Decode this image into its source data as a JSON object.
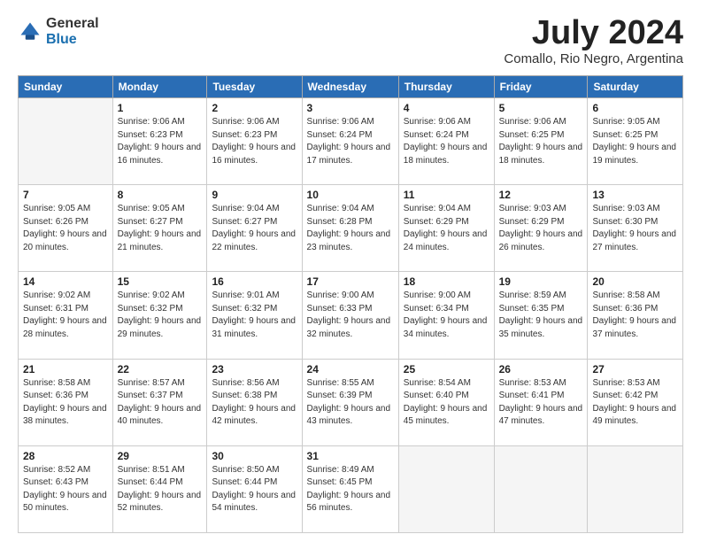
{
  "header": {
    "logo_general": "General",
    "logo_blue": "Blue",
    "month_title": "July 2024",
    "location": "Comallo, Rio Negro, Argentina"
  },
  "calendar": {
    "days_of_week": [
      "Sunday",
      "Monday",
      "Tuesday",
      "Wednesday",
      "Thursday",
      "Friday",
      "Saturday"
    ],
    "weeks": [
      [
        {
          "day": "",
          "sunrise": "",
          "sunset": "",
          "daylight": ""
        },
        {
          "day": "1",
          "sunrise": "Sunrise: 9:06 AM",
          "sunset": "Sunset: 6:23 PM",
          "daylight": "Daylight: 9 hours and 16 minutes."
        },
        {
          "day": "2",
          "sunrise": "Sunrise: 9:06 AM",
          "sunset": "Sunset: 6:23 PM",
          "daylight": "Daylight: 9 hours and 16 minutes."
        },
        {
          "day": "3",
          "sunrise": "Sunrise: 9:06 AM",
          "sunset": "Sunset: 6:24 PM",
          "daylight": "Daylight: 9 hours and 17 minutes."
        },
        {
          "day": "4",
          "sunrise": "Sunrise: 9:06 AM",
          "sunset": "Sunset: 6:24 PM",
          "daylight": "Daylight: 9 hours and 18 minutes."
        },
        {
          "day": "5",
          "sunrise": "Sunrise: 9:06 AM",
          "sunset": "Sunset: 6:25 PM",
          "daylight": "Daylight: 9 hours and 18 minutes."
        },
        {
          "day": "6",
          "sunrise": "Sunrise: 9:05 AM",
          "sunset": "Sunset: 6:25 PM",
          "daylight": "Daylight: 9 hours and 19 minutes."
        }
      ],
      [
        {
          "day": "7",
          "sunrise": "Sunrise: 9:05 AM",
          "sunset": "Sunset: 6:26 PM",
          "daylight": "Daylight: 9 hours and 20 minutes."
        },
        {
          "day": "8",
          "sunrise": "Sunrise: 9:05 AM",
          "sunset": "Sunset: 6:27 PM",
          "daylight": "Daylight: 9 hours and 21 minutes."
        },
        {
          "day": "9",
          "sunrise": "Sunrise: 9:04 AM",
          "sunset": "Sunset: 6:27 PM",
          "daylight": "Daylight: 9 hours and 22 minutes."
        },
        {
          "day": "10",
          "sunrise": "Sunrise: 9:04 AM",
          "sunset": "Sunset: 6:28 PM",
          "daylight": "Daylight: 9 hours and 23 minutes."
        },
        {
          "day": "11",
          "sunrise": "Sunrise: 9:04 AM",
          "sunset": "Sunset: 6:29 PM",
          "daylight": "Daylight: 9 hours and 24 minutes."
        },
        {
          "day": "12",
          "sunrise": "Sunrise: 9:03 AM",
          "sunset": "Sunset: 6:29 PM",
          "daylight": "Daylight: 9 hours and 26 minutes."
        },
        {
          "day": "13",
          "sunrise": "Sunrise: 9:03 AM",
          "sunset": "Sunset: 6:30 PM",
          "daylight": "Daylight: 9 hours and 27 minutes."
        }
      ],
      [
        {
          "day": "14",
          "sunrise": "Sunrise: 9:02 AM",
          "sunset": "Sunset: 6:31 PM",
          "daylight": "Daylight: 9 hours and 28 minutes."
        },
        {
          "day": "15",
          "sunrise": "Sunrise: 9:02 AM",
          "sunset": "Sunset: 6:32 PM",
          "daylight": "Daylight: 9 hours and 29 minutes."
        },
        {
          "day": "16",
          "sunrise": "Sunrise: 9:01 AM",
          "sunset": "Sunset: 6:32 PM",
          "daylight": "Daylight: 9 hours and 31 minutes."
        },
        {
          "day": "17",
          "sunrise": "Sunrise: 9:00 AM",
          "sunset": "Sunset: 6:33 PM",
          "daylight": "Daylight: 9 hours and 32 minutes."
        },
        {
          "day": "18",
          "sunrise": "Sunrise: 9:00 AM",
          "sunset": "Sunset: 6:34 PM",
          "daylight": "Daylight: 9 hours and 34 minutes."
        },
        {
          "day": "19",
          "sunrise": "Sunrise: 8:59 AM",
          "sunset": "Sunset: 6:35 PM",
          "daylight": "Daylight: 9 hours and 35 minutes."
        },
        {
          "day": "20",
          "sunrise": "Sunrise: 8:58 AM",
          "sunset": "Sunset: 6:36 PM",
          "daylight": "Daylight: 9 hours and 37 minutes."
        }
      ],
      [
        {
          "day": "21",
          "sunrise": "Sunrise: 8:58 AM",
          "sunset": "Sunset: 6:36 PM",
          "daylight": "Daylight: 9 hours and 38 minutes."
        },
        {
          "day": "22",
          "sunrise": "Sunrise: 8:57 AM",
          "sunset": "Sunset: 6:37 PM",
          "daylight": "Daylight: 9 hours and 40 minutes."
        },
        {
          "day": "23",
          "sunrise": "Sunrise: 8:56 AM",
          "sunset": "Sunset: 6:38 PM",
          "daylight": "Daylight: 9 hours and 42 minutes."
        },
        {
          "day": "24",
          "sunrise": "Sunrise: 8:55 AM",
          "sunset": "Sunset: 6:39 PM",
          "daylight": "Daylight: 9 hours and 43 minutes."
        },
        {
          "day": "25",
          "sunrise": "Sunrise: 8:54 AM",
          "sunset": "Sunset: 6:40 PM",
          "daylight": "Daylight: 9 hours and 45 minutes."
        },
        {
          "day": "26",
          "sunrise": "Sunrise: 8:53 AM",
          "sunset": "Sunset: 6:41 PM",
          "daylight": "Daylight: 9 hours and 47 minutes."
        },
        {
          "day": "27",
          "sunrise": "Sunrise: 8:53 AM",
          "sunset": "Sunset: 6:42 PM",
          "daylight": "Daylight: 9 hours and 49 minutes."
        }
      ],
      [
        {
          "day": "28",
          "sunrise": "Sunrise: 8:52 AM",
          "sunset": "Sunset: 6:43 PM",
          "daylight": "Daylight: 9 hours and 50 minutes."
        },
        {
          "day": "29",
          "sunrise": "Sunrise: 8:51 AM",
          "sunset": "Sunset: 6:44 PM",
          "daylight": "Daylight: 9 hours and 52 minutes."
        },
        {
          "day": "30",
          "sunrise": "Sunrise: 8:50 AM",
          "sunset": "Sunset: 6:44 PM",
          "daylight": "Daylight: 9 hours and 54 minutes."
        },
        {
          "day": "31",
          "sunrise": "Sunrise: 8:49 AM",
          "sunset": "Sunset: 6:45 PM",
          "daylight": "Daylight: 9 hours and 56 minutes."
        },
        {
          "day": "",
          "sunrise": "",
          "sunset": "",
          "daylight": ""
        },
        {
          "day": "",
          "sunrise": "",
          "sunset": "",
          "daylight": ""
        },
        {
          "day": "",
          "sunrise": "",
          "sunset": "",
          "daylight": ""
        }
      ]
    ]
  }
}
